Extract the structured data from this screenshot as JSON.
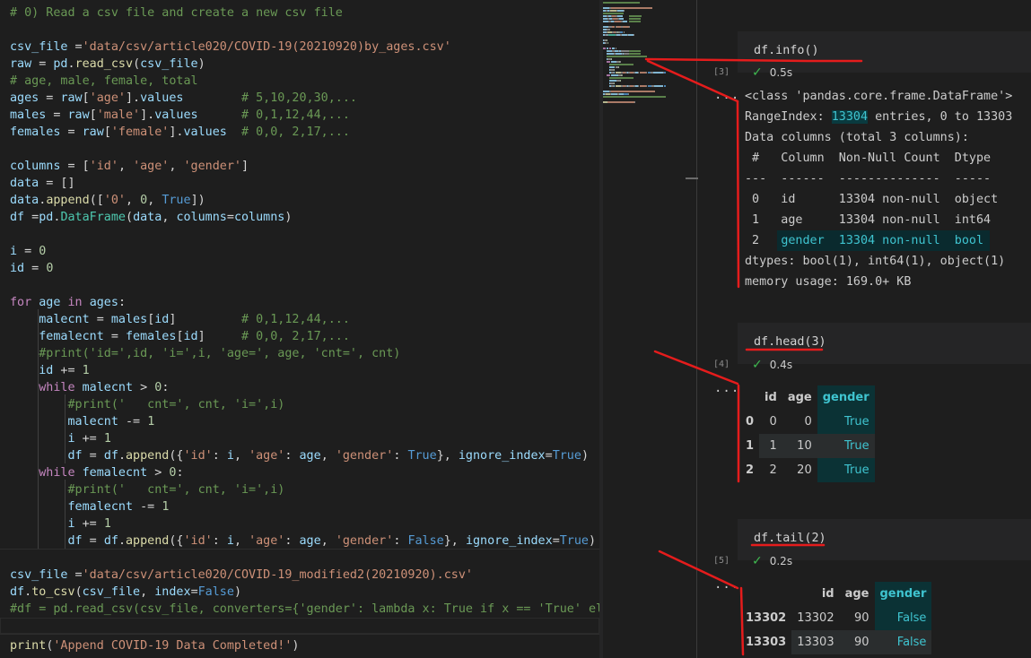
{
  "editor": {
    "lines": [
      [
        [
          "c-comment",
          "# 0) Read a csv file and create a new csv file"
        ]
      ],
      [],
      [
        [
          "c-var",
          "csv_file"
        ],
        [
          "c-plain",
          " ="
        ],
        [
          "c-string",
          "'data/csv/article020/COVID-19(20210920)by_ages.csv'"
        ]
      ],
      [
        [
          "c-var",
          "raw"
        ],
        [
          "c-plain",
          " = "
        ],
        [
          "c-var",
          "pd"
        ],
        [
          "c-plain",
          "."
        ],
        [
          "c-func",
          "read_csv"
        ],
        [
          "c-plain",
          "("
        ],
        [
          "c-var",
          "csv_file"
        ],
        [
          "c-plain",
          ")"
        ]
      ],
      [
        [
          "c-comment",
          "# age, male, female, total"
        ]
      ],
      [
        [
          "c-var",
          "ages"
        ],
        [
          "c-plain",
          " = "
        ],
        [
          "c-var",
          "raw"
        ],
        [
          "c-plain",
          "["
        ],
        [
          "c-string",
          "'age'"
        ],
        [
          "c-plain",
          "]."
        ],
        [
          "c-var",
          "values"
        ],
        [
          "c-plain",
          "        "
        ],
        [
          "c-comment",
          "# 5,10,20,30,..."
        ]
      ],
      [
        [
          "c-var",
          "males"
        ],
        [
          "c-plain",
          " = "
        ],
        [
          "c-var",
          "raw"
        ],
        [
          "c-plain",
          "["
        ],
        [
          "c-string",
          "'male'"
        ],
        [
          "c-plain",
          "]."
        ],
        [
          "c-var",
          "values"
        ],
        [
          "c-plain",
          "      "
        ],
        [
          "c-comment",
          "# 0,1,12,44,..."
        ]
      ],
      [
        [
          "c-var",
          "females"
        ],
        [
          "c-plain",
          " = "
        ],
        [
          "c-var",
          "raw"
        ],
        [
          "c-plain",
          "["
        ],
        [
          "c-string",
          "'female'"
        ],
        [
          "c-plain",
          "]."
        ],
        [
          "c-var",
          "values"
        ],
        [
          "c-plain",
          "  "
        ],
        [
          "c-comment",
          "# 0,0, 2,17,..."
        ]
      ],
      [],
      [
        [
          "c-var",
          "columns"
        ],
        [
          "c-plain",
          " = ["
        ],
        [
          "c-string",
          "'id'"
        ],
        [
          "c-plain",
          ", "
        ],
        [
          "c-string",
          "'age'"
        ],
        [
          "c-plain",
          ", "
        ],
        [
          "c-string",
          "'gender'"
        ],
        [
          "c-plain",
          "]"
        ]
      ],
      [
        [
          "c-var",
          "data"
        ],
        [
          "c-plain",
          " = []"
        ]
      ],
      [
        [
          "c-var",
          "data"
        ],
        [
          "c-plain",
          "."
        ],
        [
          "c-func",
          "append"
        ],
        [
          "c-plain",
          "(["
        ],
        [
          "c-string",
          "'0'"
        ],
        [
          "c-plain",
          ", "
        ],
        [
          "c-num",
          "0"
        ],
        [
          "c-plain",
          ", "
        ],
        [
          "c-const",
          "True"
        ],
        [
          "c-plain",
          "])"
        ]
      ],
      [
        [
          "c-var",
          "df"
        ],
        [
          "c-plain",
          " ="
        ],
        [
          "c-var",
          "pd"
        ],
        [
          "c-plain",
          "."
        ],
        [
          "c-cls",
          "DataFrame"
        ],
        [
          "c-plain",
          "("
        ],
        [
          "c-var",
          "data"
        ],
        [
          "c-plain",
          ", "
        ],
        [
          "c-var",
          "columns"
        ],
        [
          "c-plain",
          "="
        ],
        [
          "c-var",
          "columns"
        ],
        [
          "c-plain",
          ")"
        ]
      ],
      [],
      [
        [
          "c-var",
          "i"
        ],
        [
          "c-plain",
          " = "
        ],
        [
          "c-num",
          "0"
        ]
      ],
      [
        [
          "c-var",
          "id"
        ],
        [
          "c-plain",
          " = "
        ],
        [
          "c-num",
          "0"
        ]
      ],
      [],
      [
        [
          "c-kw",
          "for"
        ],
        [
          "c-plain",
          " "
        ],
        [
          "c-var",
          "age"
        ],
        [
          "c-plain",
          " "
        ],
        [
          "c-kw",
          "in"
        ],
        [
          "c-plain",
          " "
        ],
        [
          "c-var",
          "ages"
        ],
        [
          "c-plain",
          ":"
        ]
      ],
      [
        [
          "c-plain",
          "    "
        ],
        [
          "c-var",
          "malecnt"
        ],
        [
          "c-plain",
          " = "
        ],
        [
          "c-var",
          "males"
        ],
        [
          "c-plain",
          "["
        ],
        [
          "c-var",
          "id"
        ],
        [
          "c-plain",
          "]         "
        ],
        [
          "c-comment",
          "# 0,1,12,44,..."
        ]
      ],
      [
        [
          "c-plain",
          "    "
        ],
        [
          "c-var",
          "femalecnt"
        ],
        [
          "c-plain",
          " = "
        ],
        [
          "c-var",
          "females"
        ],
        [
          "c-plain",
          "["
        ],
        [
          "c-var",
          "id"
        ],
        [
          "c-plain",
          "]     "
        ],
        [
          "c-comment",
          "# 0,0, 2,17,..."
        ]
      ],
      [
        [
          "c-plain",
          "    "
        ],
        [
          "c-comment",
          "#print('id=',id, 'i=',i, 'age=', age, 'cnt=', cnt)"
        ]
      ],
      [
        [
          "c-plain",
          "    "
        ],
        [
          "c-var",
          "id"
        ],
        [
          "c-plain",
          " += "
        ],
        [
          "c-num",
          "1"
        ]
      ],
      [
        [
          "c-plain",
          "    "
        ],
        [
          "c-kw",
          "while"
        ],
        [
          "c-plain",
          " "
        ],
        [
          "c-var",
          "malecnt"
        ],
        [
          "c-plain",
          " > "
        ],
        [
          "c-num",
          "0"
        ],
        [
          "c-plain",
          ":"
        ]
      ],
      [
        [
          "c-plain",
          "        "
        ],
        [
          "c-comment",
          "#print('   cnt=', cnt, 'i=',i)"
        ]
      ],
      [
        [
          "c-plain",
          "        "
        ],
        [
          "c-var",
          "malecnt"
        ],
        [
          "c-plain",
          " -= "
        ],
        [
          "c-num",
          "1"
        ]
      ],
      [
        [
          "c-plain",
          "        "
        ],
        [
          "c-var",
          "i"
        ],
        [
          "c-plain",
          " += "
        ],
        [
          "c-num",
          "1"
        ]
      ],
      [
        [
          "c-plain",
          "        "
        ],
        [
          "c-var",
          "df"
        ],
        [
          "c-plain",
          " = "
        ],
        [
          "c-var",
          "df"
        ],
        [
          "c-plain",
          "."
        ],
        [
          "c-func",
          "append"
        ],
        [
          "c-plain",
          "({"
        ],
        [
          "c-string",
          "'id'"
        ],
        [
          "c-plain",
          ": "
        ],
        [
          "c-var",
          "i"
        ],
        [
          "c-plain",
          ", "
        ],
        [
          "c-string",
          "'age'"
        ],
        [
          "c-plain",
          ": "
        ],
        [
          "c-var",
          "age"
        ],
        [
          "c-plain",
          ", "
        ],
        [
          "c-string",
          "'gender'"
        ],
        [
          "c-plain",
          ": "
        ],
        [
          "c-const",
          "True"
        ],
        [
          "c-plain",
          "}, "
        ],
        [
          "c-var",
          "ignore_index"
        ],
        [
          "c-plain",
          "="
        ],
        [
          "c-const",
          "True"
        ],
        [
          "c-plain",
          ")"
        ]
      ],
      [
        [
          "c-plain",
          "    "
        ],
        [
          "c-kw",
          "while"
        ],
        [
          "c-plain",
          " "
        ],
        [
          "c-var",
          "femalecnt"
        ],
        [
          "c-plain",
          " > "
        ],
        [
          "c-num",
          "0"
        ],
        [
          "c-plain",
          ":"
        ]
      ],
      [
        [
          "c-plain",
          "        "
        ],
        [
          "c-comment",
          "#print('   cnt=', cnt, 'i=',i)"
        ]
      ],
      [
        [
          "c-plain",
          "        "
        ],
        [
          "c-var",
          "femalecnt"
        ],
        [
          "c-plain",
          " -= "
        ],
        [
          "c-num",
          "1"
        ]
      ],
      [
        [
          "c-plain",
          "        "
        ],
        [
          "c-var",
          "i"
        ],
        [
          "c-plain",
          " += "
        ],
        [
          "c-num",
          "1"
        ]
      ],
      [
        [
          "c-plain",
          "        "
        ],
        [
          "c-var",
          "df"
        ],
        [
          "c-plain",
          " = "
        ],
        [
          "c-var",
          "df"
        ],
        [
          "c-plain",
          "."
        ],
        [
          "c-func",
          "append"
        ],
        [
          "c-plain",
          "({"
        ],
        [
          "c-string",
          "'id'"
        ],
        [
          "c-plain",
          ": "
        ],
        [
          "c-var",
          "i"
        ],
        [
          "c-plain",
          ", "
        ],
        [
          "c-string",
          "'age'"
        ],
        [
          "c-plain",
          ": "
        ],
        [
          "c-var",
          "age"
        ],
        [
          "c-plain",
          ", "
        ],
        [
          "c-string",
          "'gender'"
        ],
        [
          "c-plain",
          ": "
        ],
        [
          "c-const",
          "False"
        ],
        [
          "c-plain",
          "}, "
        ],
        [
          "c-var",
          "ignore_index"
        ],
        [
          "c-plain",
          "="
        ],
        [
          "c-const",
          "True"
        ],
        [
          "c-plain",
          ")"
        ]
      ],
      [],
      [
        [
          "c-var",
          "csv_file"
        ],
        [
          "c-plain",
          " ="
        ],
        [
          "c-string",
          "'data/csv/article020/COVID-19_modified2(20210920).csv'"
        ]
      ],
      [
        [
          "c-var",
          "df"
        ],
        [
          "c-plain",
          "."
        ],
        [
          "c-func",
          "to_csv"
        ],
        [
          "c-plain",
          "("
        ],
        [
          "c-var",
          "csv_file"
        ],
        [
          "c-plain",
          ", "
        ],
        [
          "c-var",
          "index"
        ],
        [
          "c-plain",
          "="
        ],
        [
          "c-const",
          "False"
        ],
        [
          "c-plain",
          ")"
        ]
      ],
      [
        [
          "c-comment",
          "#df = pd.read_csv(csv_file, converters={'gender': lambda x: True if x == 'True' else F"
        ]
      ],
      [],
      [
        [
          "c-func",
          "print"
        ],
        [
          "c-plain",
          "("
        ],
        [
          "c-string",
          "'Append COVID-19 Data Completed!'"
        ],
        [
          "c-plain",
          ")"
        ]
      ]
    ]
  },
  "cells": [
    {
      "code": "df.info()",
      "exec_count": "[3]",
      "time": "0.5s"
    },
    {
      "code": "df.head(3)",
      "exec_count": "[4]",
      "time": "0.4s"
    },
    {
      "code": "df.tail(2)",
      "exec_count": "[5]",
      "time": "0.2s"
    }
  ],
  "info_output": {
    "line1": "<class 'pandas.core.frame.DataFrame'>",
    "range_prefix": "RangeIndex: ",
    "range_count": "13304",
    "range_suffix": " entries, 0 to 13303",
    "line3": "Data columns (total 3 columns):",
    "header": " #   Column  Non-Null Count  Dtype ",
    "dashes": "---  ------  --------------  ----- ",
    "row0": " 0   id      13304 non-null  object",
    "row1": " 1   age     13304 non-null  int64 ",
    "row2_prefix": " 2   ",
    "row2_hl": "gender  13304 non-null  bool",
    "dtypes": "dtypes: bool(1), int64(1), object(1)",
    "memory": "memory usage: 169.0+ KB"
  },
  "head_table": {
    "columns": [
      "",
      "id",
      "age",
      "gender"
    ],
    "rows": [
      [
        "0",
        "0",
        "0",
        "True"
      ],
      [
        "1",
        "1",
        "10",
        "True"
      ],
      [
        "2",
        "2",
        "20",
        "True"
      ]
    ]
  },
  "tail_table": {
    "columns": [
      "",
      "id",
      "age",
      "gender"
    ],
    "rows": [
      [
        "13302",
        "13302",
        "90",
        "False"
      ],
      [
        "13303",
        "13303",
        "90",
        "False"
      ]
    ]
  },
  "ellipsis": "...",
  "checkmark": "✓",
  "colors": {
    "annotation": "#e51c1c",
    "accent": "#3fc4d0",
    "success": "#3fb950"
  }
}
